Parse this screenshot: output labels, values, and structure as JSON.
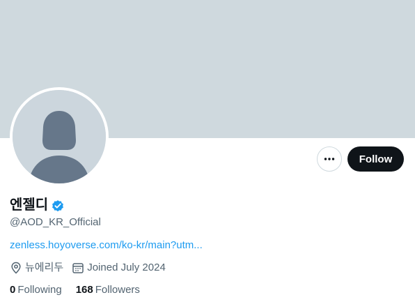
{
  "profile": {
    "display_name": "엔젤디",
    "handle": "@AOD_KR_Official",
    "website": "zenless.hoyoverse.com/ko-kr/main?utm...",
    "location": "뉴에리두",
    "joined": "Joined July 2024",
    "verified": true
  },
  "actions": {
    "more_icon": "more-horizontal-icon",
    "follow_label": "Follow"
  },
  "stats": {
    "following_count": "0",
    "following_label": "Following",
    "followers_count": "168",
    "followers_label": "Followers"
  },
  "colors": {
    "banner": "#cfd9de",
    "link": "#1d9bf0",
    "verified_badge": "#1d9bf0",
    "follow_button": "#0f1419",
    "secondary_text": "#536471"
  }
}
